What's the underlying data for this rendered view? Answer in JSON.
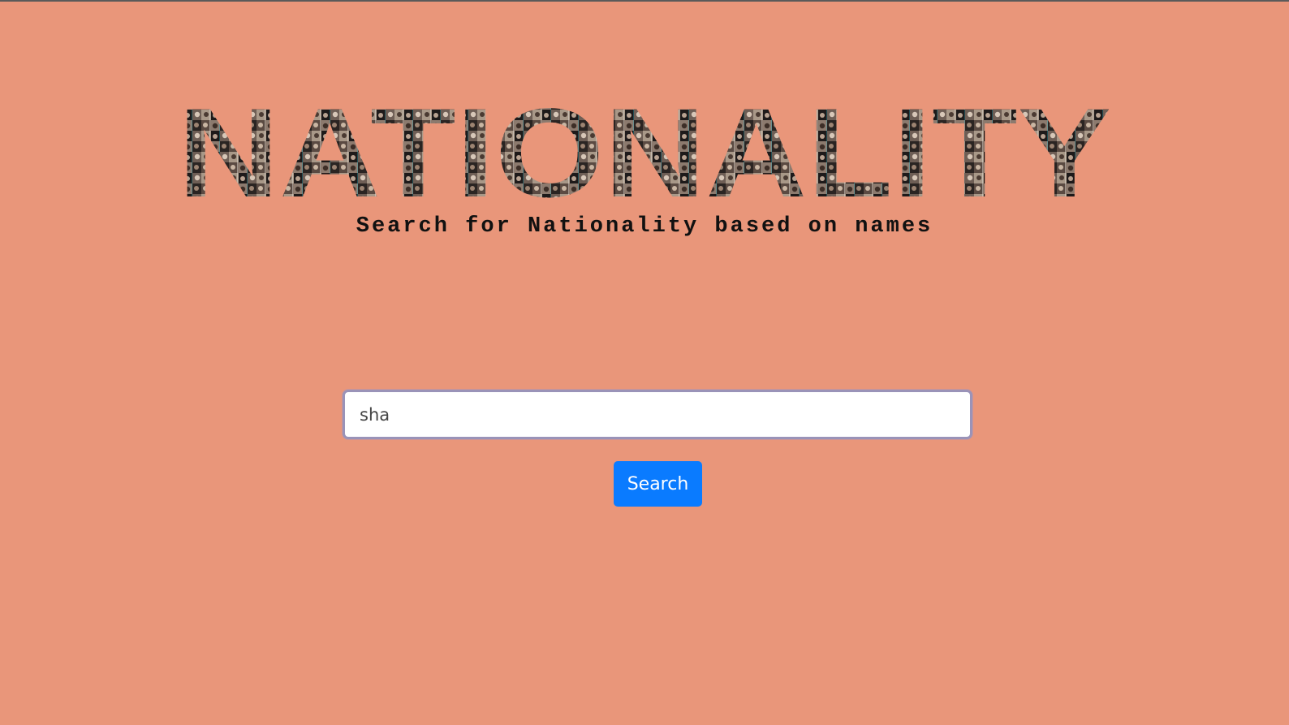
{
  "header": {
    "title": "NATIONALITY",
    "subtitle": "Search for Nationality based on names"
  },
  "search": {
    "value": "sha",
    "button_label": "Search"
  },
  "colors": {
    "background": "#e9967a",
    "button": "#0a7bff",
    "input_border": "#9a93b8"
  }
}
